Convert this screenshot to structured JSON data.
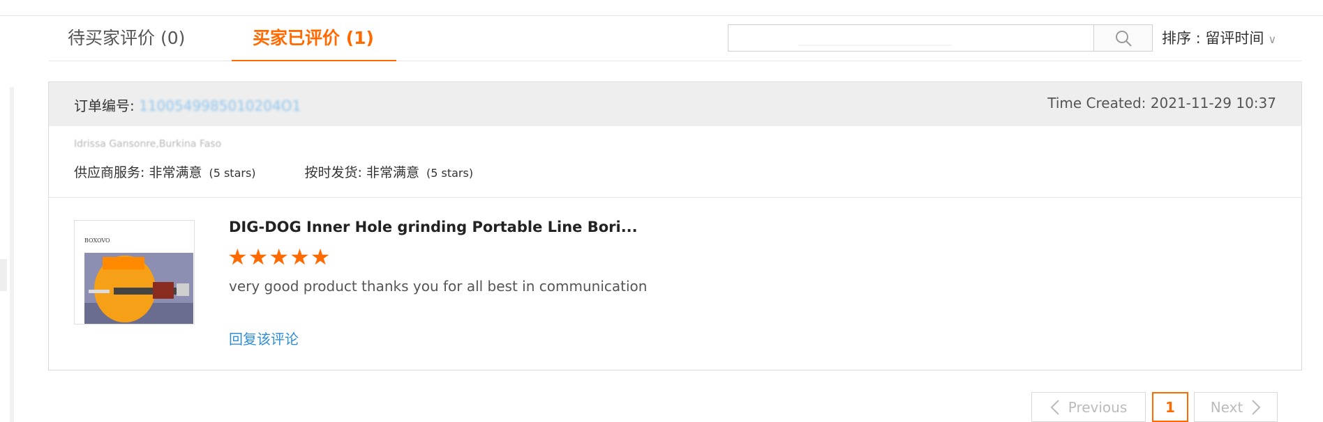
{
  "tabs": {
    "pending_label": "待买家评价 (0)",
    "reviewed_label": "买家已评价 (1)"
  },
  "search": {
    "value": "",
    "placeholder": ""
  },
  "sort": {
    "label": "排序 : 留评时间",
    "chevron_icon": "chevron-down-icon"
  },
  "order": {
    "number_label": "订单编号:",
    "number_value": "1100549985010204O1",
    "time_created": "Time Created: 2021-11-29 10:37",
    "buyer": "Idrissa Gansonre,Burkina Faso",
    "supplier_service_label": "供应商服务: 非常满意",
    "supplier_service_stars": "(5 stars)",
    "ontime_label": "按时发货: 非常满意",
    "ontime_stars": "(5 stars)"
  },
  "review": {
    "product_title": "DIG-DOG Inner Hole grinding Portable Line Bori...",
    "stars": "★★★★★",
    "rating": 5,
    "text": "very good product thanks you for all best in communication",
    "reply_label": "回复该评论",
    "image_brand": "BOXOVO"
  },
  "pagination": {
    "previous_label": "Previous",
    "current_page": "1",
    "next_label": "Next"
  },
  "colors": {
    "accent": "#ff6a00",
    "link": "#2f8ed8"
  }
}
